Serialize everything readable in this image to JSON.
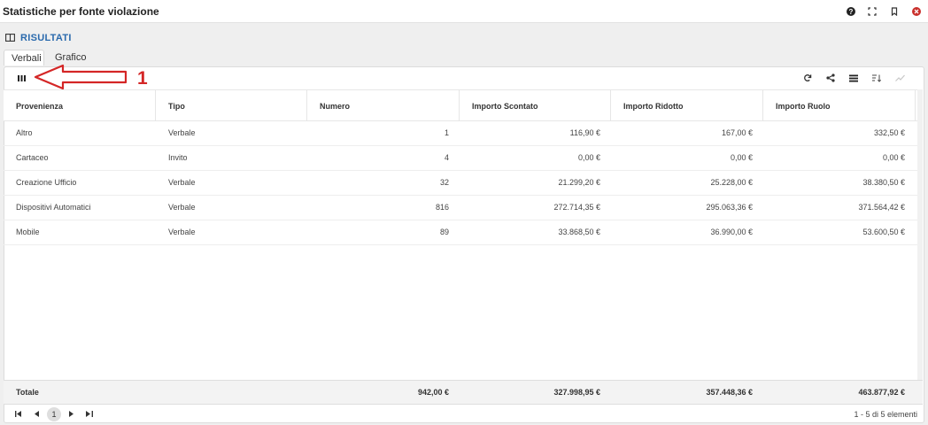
{
  "window": {
    "title": "Statistiche per fonte violazione"
  },
  "window_buttons": [
    "help-icon",
    "expand-icon",
    "bookmark-icon",
    "close-icon"
  ],
  "section": {
    "title": "RISULTATI",
    "icon": "panel-icon"
  },
  "tabs": [
    {
      "label": "Verbali",
      "active": true
    },
    {
      "label": "Grafico",
      "active": false
    }
  ],
  "annotation": {
    "label": "1",
    "color": "#d42626"
  },
  "toolbar_icons": [
    "refresh-icon",
    "share-icon",
    "list-icon",
    "sort-icon",
    "chart-line-icon"
  ],
  "grid": {
    "columns": [
      "Provenienza",
      "Tipo",
      "Numero",
      "Importo Scontato",
      "Importo Ridotto",
      "Importo Ruolo"
    ],
    "rows": [
      [
        "Altro",
        "Verbale",
        "1",
        "116,90 €",
        "167,00 €",
        "332,50 €"
      ],
      [
        "Cartaceo",
        "Invito",
        "4",
        "0,00 €",
        "0,00 €",
        "0,00 €"
      ],
      [
        "Creazione Ufficio",
        "Verbale",
        "32",
        "21.299,20 €",
        "25.228,00 €",
        "38.380,50 €"
      ],
      [
        "Dispositivi Automatici",
        "Verbale",
        "816",
        "272.714,35 €",
        "295.063,36 €",
        "371.564,42 €"
      ],
      [
        "Mobile",
        "Verbale",
        "89",
        "33.868,50 €",
        "36.990,00 €",
        "53.600,50 €"
      ]
    ],
    "totals": {
      "label": "Totale",
      "numero": "942,00 €",
      "scontato": "327.998,95 €",
      "ridotto": "357.448,36 €",
      "ruolo": "463.877,92 €"
    }
  },
  "pager": {
    "current_page": "1",
    "info": "1 - 5 di 5 elementi"
  },
  "colors": {
    "accent": "#2a6aad",
    "annotation": "#d42626"
  }
}
